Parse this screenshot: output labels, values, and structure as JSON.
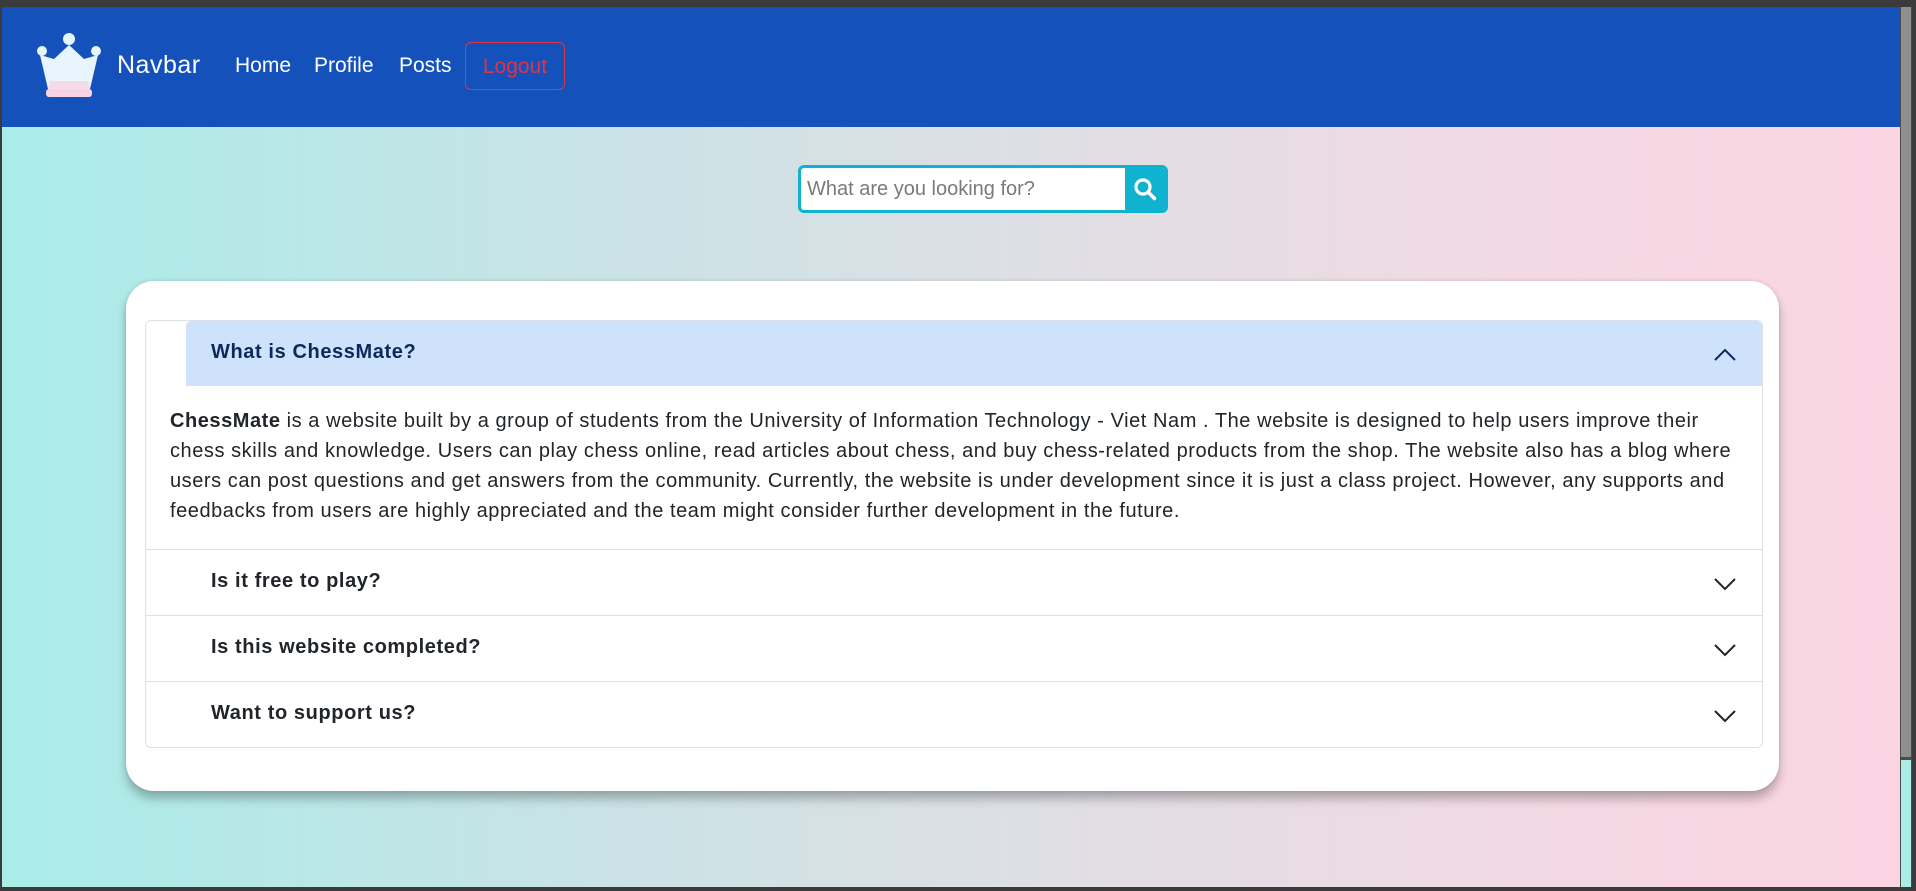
{
  "navbar": {
    "brand": "Navbar",
    "links": [
      "Home",
      "Profile",
      "Posts"
    ],
    "logout_label": "Logout",
    "logo_icon": "crown-icon"
  },
  "search": {
    "placeholder": "What are you looking for?",
    "value": "",
    "icon": "search-icon"
  },
  "faq": {
    "items": [
      {
        "question": "What is ChessMate?",
        "expanded": true,
        "answer_bold": "ChessMate",
        "answer": " is a website built by a group of students from the University of Information Technology - Viet Nam . The website is designed to help users improve their chess skills and knowledge. Users can play chess online, read articles about chess, and buy chess-related products from the shop. The website also has a blog where users can post questions and get answers from the community. Currently, the website is under development since it is just a class project. However, any supports and feedbacks from users are highly appreciated and the team might consider further development in the future."
      },
      {
        "question": "Is it free to play?",
        "expanded": false
      },
      {
        "question": "Is this website completed?",
        "expanded": false
      },
      {
        "question": "Want to support us?",
        "expanded": false
      }
    ]
  },
  "colors": {
    "navbar": "#1551bb",
    "logout": "#dc3545",
    "search_accent": "#10b3cf",
    "accordion_active": "#cfe2fc"
  }
}
